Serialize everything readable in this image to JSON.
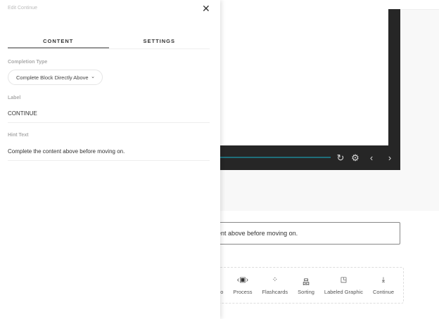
{
  "panel": {
    "title": "Edit Continue",
    "tabs": [
      "CONTENT",
      "SETTINGS"
    ],
    "completion_type_label": "Completion Type",
    "completion_type_value": "Complete Block Directly Above",
    "label_label": "Label",
    "label_value": "CONTINUE",
    "hint_label": "Hint Text",
    "hint_value": "Complete the content above before moving on."
  },
  "background": {
    "hint_text": "Complete the content above before moving on.",
    "blocks": [
      "Video",
      "Process",
      "Flashcards",
      "Sorting",
      "Labeled Graphic",
      "Continue"
    ],
    "accent": "#1f6e7a"
  }
}
